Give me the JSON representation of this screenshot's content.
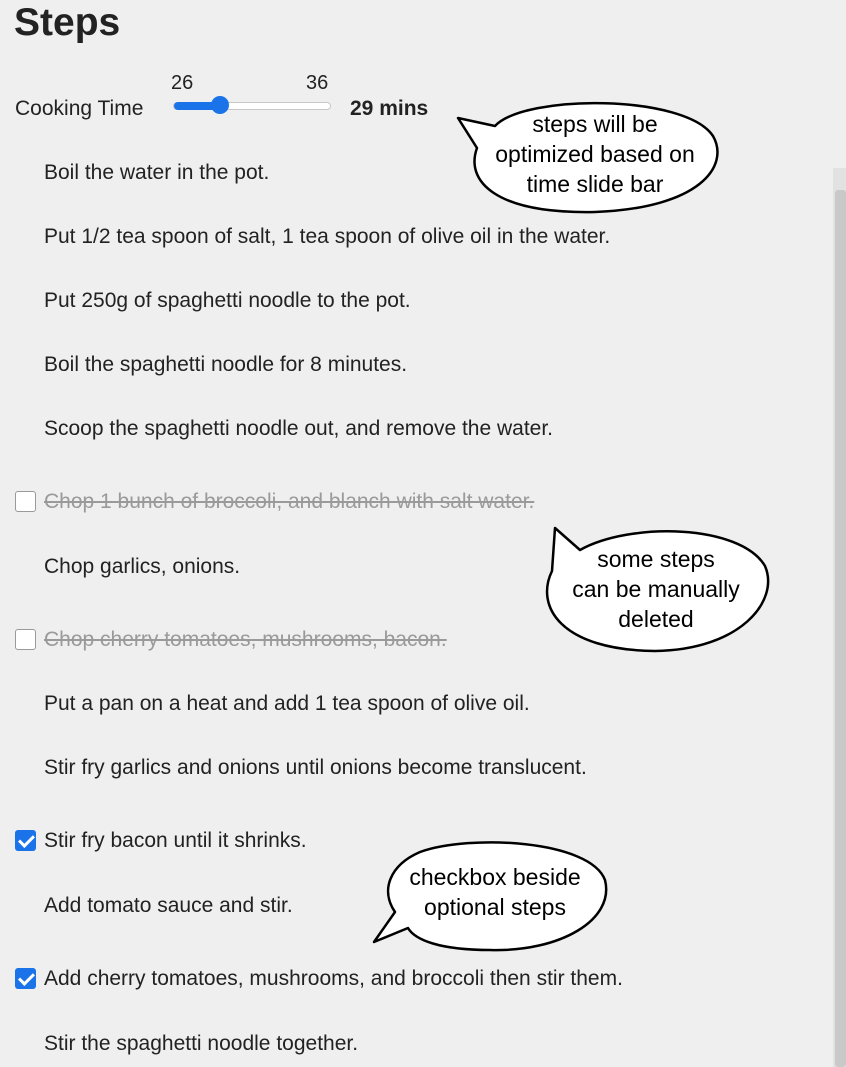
{
  "title": "Steps",
  "cooking_time": {
    "label": "Cooking Time",
    "min": "26",
    "max": "36",
    "value": 29,
    "value_text": "29 mins",
    "accent_color": "#1a73e8"
  },
  "steps": [
    {
      "text": "Boil the water in the pot.",
      "optional": false,
      "checked": null
    },
    {
      "text": "Put 1/2 tea spoon of salt, 1 tea spoon of olive oil in the water.",
      "optional": false,
      "checked": null
    },
    {
      "text": "Put 250g of spaghetti noodle to the pot.",
      "optional": false,
      "checked": null
    },
    {
      "text": "Boil the spaghetti noodle for 8 minutes.",
      "optional": false,
      "checked": null
    },
    {
      "text": "Scoop the spaghetti noodle out, and remove the water.",
      "optional": false,
      "checked": null
    },
    {
      "text": "Chop 1 bunch of broccoli, and blanch with salt water.",
      "optional": true,
      "checked": false
    },
    {
      "text": "Chop garlics, onions.",
      "optional": false,
      "checked": null
    },
    {
      "text": "Chop cherry tomatoes, mushrooms, bacon.",
      "optional": true,
      "checked": false
    },
    {
      "text": "Put a pan on a heat and add 1 tea spoon of olive oil.",
      "optional": false,
      "checked": null
    },
    {
      "text": "Stir fry garlics and onions until onions become translucent.",
      "optional": false,
      "checked": null
    },
    {
      "text": "Stir fry bacon until it shrinks.",
      "optional": true,
      "checked": true
    },
    {
      "text": "Add tomato sauce and stir.",
      "optional": false,
      "checked": null
    },
    {
      "text": "Add cherry tomatoes, mushrooms, and broccoli then stir them.",
      "optional": true,
      "checked": true
    },
    {
      "text": "Stir the spaghetti noodle together.",
      "optional": false,
      "checked": null
    }
  ],
  "callouts": {
    "slider_note": [
      "steps will be",
      "optimized based on",
      "time slide bar"
    ],
    "delete_note": [
      "some steps",
      "can be manually",
      "deleted"
    ],
    "checkbox_note": [
      "checkbox beside",
      "optional steps"
    ]
  }
}
